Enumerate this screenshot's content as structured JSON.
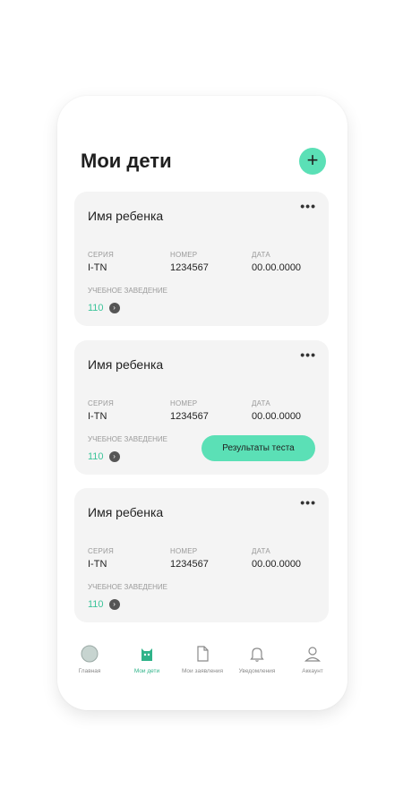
{
  "header": {
    "title": "Мои дети",
    "add_label": "+"
  },
  "cards": [
    {
      "name": "Имя ребенка",
      "more": "•••",
      "fields": [
        {
          "label": "Серия",
          "value": "I-TN"
        },
        {
          "label": "Номер",
          "value": "1234567"
        },
        {
          "label": "Дата",
          "value": "00.00.0000"
        }
      ],
      "school_label": "Учебное заведение",
      "school_value": "110"
    },
    {
      "name": "Имя ребенка",
      "more": "•••",
      "fields": [
        {
          "label": "Серия",
          "value": "I-TN"
        },
        {
          "label": "Номер",
          "value": "1234567"
        },
        {
          "label": "Дата",
          "value": "00.00.0000"
        }
      ],
      "school_label": "Учебное заведение",
      "school_value": "110",
      "results_button": "Результаты теста"
    },
    {
      "name": "Имя ребенка",
      "more": "•••",
      "fields": [
        {
          "label": "Серия",
          "value": "I-TN"
        },
        {
          "label": "Номер",
          "value": "1234567"
        },
        {
          "label": "Дата",
          "value": "00.00.0000"
        }
      ],
      "school_label": "Учебное заведение",
      "school_value": "110"
    }
  ],
  "tabs": [
    {
      "label": "Главная",
      "icon": "home-icon"
    },
    {
      "label": "Мои дети",
      "icon": "child-icon",
      "active": true
    },
    {
      "label": "Мои заявления",
      "icon": "document-icon"
    },
    {
      "label": "Уведомления",
      "icon": "bell-icon"
    },
    {
      "label": "Аккаунт",
      "icon": "account-icon"
    }
  ],
  "colors": {
    "accent": "#5be0b6",
    "accent_text": "#2fb389",
    "card_bg": "#f4f4f4"
  }
}
